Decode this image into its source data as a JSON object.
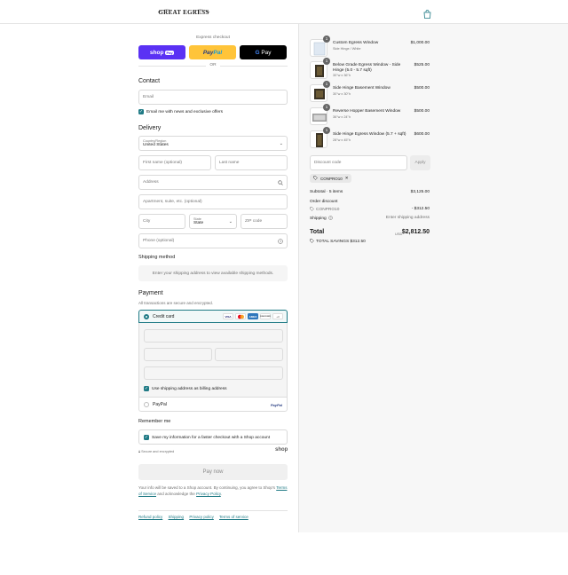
{
  "header": {
    "logo_text": "GREAT EGRESS"
  },
  "express": {
    "title": "Express checkout",
    "shoppay": "shop",
    "shoppay_pill": "Pay",
    "paypal_a": "Pay",
    "paypal_b": "Pal",
    "gpay_g": "G",
    "gpay_text": "Pay",
    "or": "OR"
  },
  "contact": {
    "heading": "Contact",
    "email_placeholder": "Email",
    "news_label": "Email me with news and exclusive offers"
  },
  "delivery": {
    "heading": "Delivery",
    "country_label": "Country/Region",
    "country_value": "United States",
    "first_name": "First name (optional)",
    "last_name": "Last name",
    "address": "Address",
    "apartment": "Apartment, suite, etc. (optional)",
    "city": "City",
    "state_label": "State",
    "state_value": "State",
    "zip": "ZIP code",
    "phone": "Phone (optional)"
  },
  "shipping_method": {
    "heading": "Shipping method",
    "message": "Enter your shipping address to view available shipping methods."
  },
  "payment": {
    "heading": "Payment",
    "subtitle": "All transactions are secure and encrypted.",
    "credit_card": "Credit card",
    "card_visa": "VISA",
    "card_amex": "AMEX",
    "card_discover": "DISCOVER",
    "card_more": "+3",
    "billing_label": "Use shipping address as billing address",
    "paypal": "PayPal",
    "paypal_logo": "PayPal"
  },
  "remember": {
    "heading": "Remember me",
    "label": "Save my information for a faster checkout with a Shop account",
    "secure": "Secure and encrypted",
    "shop": "shop"
  },
  "paynow": "Pay now",
  "terms": {
    "text1": "Your info will be saved to a Shop account. By continuing, you agree to Shop's",
    "terms_link": "Terms of Service",
    "text2": "and acknowledge the",
    "privacy_link": "Privacy Policy",
    "text3": "."
  },
  "footer": [
    "Refund policy",
    "Shipping",
    "Privacy policy",
    "Terms of service"
  ],
  "order": {
    "items": [
      {
        "qty": "1",
        "name": "Custom Egress Window",
        "variant": "Side Hinge / White",
        "price": "$1,000.00"
      },
      {
        "qty": "1",
        "name": "Below Grade Egress Window - Side Hinge (5.0 - 5.7 sqft)",
        "variant": "30\"w x 36\"h",
        "price": "$525.00"
      },
      {
        "qty": "1",
        "name": "Side Hinge Basement Window",
        "variant": "30\"w x 30\"h",
        "price": "$500.00"
      },
      {
        "qty": "1",
        "name": "Reverse Hopper Basement Window",
        "variant": "36\"w x 24\"h",
        "price": "$500.00"
      },
      {
        "qty": "1",
        "name": "Side Hinge Egress Window (5.7 + sqft)",
        "variant": "28\"w x 45\"h",
        "price": "$600.00"
      }
    ],
    "discount_placeholder": "Discount code",
    "apply": "Apply",
    "code_chip": "CONPRO10",
    "subtotal_label": "Subtotal · 5 items",
    "subtotal": "$3,125.00",
    "order_discount_label": "Order discount",
    "discount_code": "CONPRO10",
    "discount_value": "- $312.50",
    "shipping_label": "Shipping",
    "shipping_value": "Enter shipping address",
    "total_label": "Total",
    "currency": "USD",
    "total": "$2,812.50",
    "savings": "TOTAL SAVINGS $312.50"
  }
}
